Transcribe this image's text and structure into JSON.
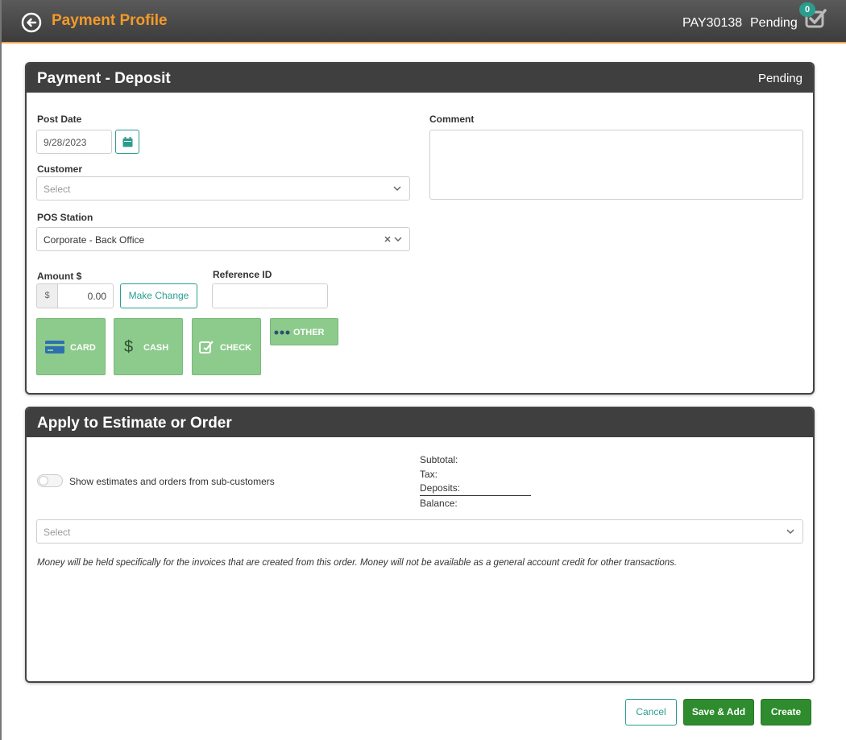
{
  "header": {
    "title": "Payment Profile",
    "payment_id": "PAY30138",
    "status": "Pending",
    "badge_count": "0"
  },
  "deposit_panel": {
    "title": "Payment - Deposit",
    "status": "Pending",
    "post_date": {
      "label": "Post Date",
      "value": "9/28/2023"
    },
    "comment": {
      "label": "Comment",
      "value": ""
    },
    "customer": {
      "label": "Customer",
      "placeholder": "Select"
    },
    "pos_station": {
      "label": "POS Station",
      "value": "Corporate - Back Office"
    },
    "amount": {
      "label": "Amount $",
      "prefix": "$",
      "value": "0.00"
    },
    "make_change_label": "Make Change",
    "reference_id": {
      "label": "Reference ID",
      "value": ""
    },
    "tenders": [
      {
        "label": "CARD",
        "icon": "credit-card-icon"
      },
      {
        "label": "CASH",
        "icon": "dollar-icon"
      },
      {
        "label": "CHECK",
        "icon": "edit-check-icon"
      },
      {
        "label": "OTHER",
        "icon": "dots-icon"
      }
    ]
  },
  "apply_panel": {
    "title": "Apply to Estimate or Order",
    "toggle_label": "Show estimates and orders from sub-customers",
    "subtotal_label": "Subtotal:",
    "tax_label": "Tax:",
    "deposits_label": "Deposits:",
    "balance_label": "Balance:",
    "select_placeholder": "Select",
    "note": "Money will be held specifically for the invoices that are created from this order. Money will not be available as a general account credit for other transactions."
  },
  "footer": {
    "cancel_label": "Cancel",
    "save_add_label": "Save & Add",
    "create_label": "Create"
  },
  "colors": {
    "accent_teal": "#2a9d8f",
    "title_orange": "#f39a2a",
    "tender_green": "#8ccb8c",
    "action_green": "#2e8b2e",
    "header_dark": "#3f3f3f"
  }
}
